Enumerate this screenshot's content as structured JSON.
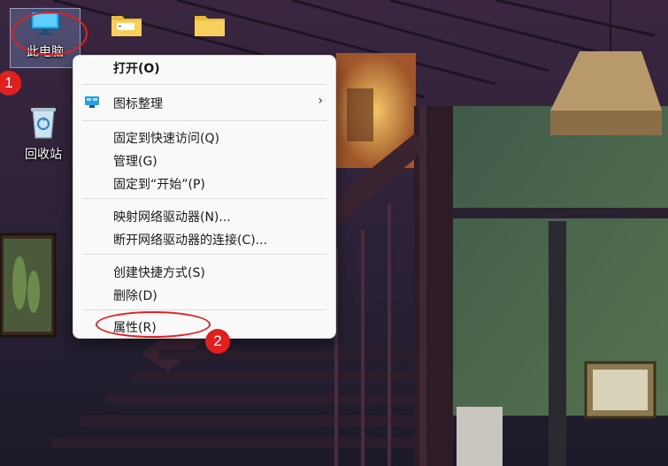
{
  "colors": {
    "menu_bg": "#f9f9f9",
    "annotation": "#e02020",
    "badge": "#e11f1f"
  },
  "desktop": {
    "icons": [
      {
        "label": "此电脑",
        "icon": "monitor-icon",
        "selected": true
      },
      {
        "label": "回收站",
        "icon": "recycle-bin-icon"
      },
      {
        "label": "",
        "icon": "folder-icon"
      },
      {
        "label": "",
        "icon": "folder-icon"
      }
    ]
  },
  "context_menu": {
    "items": [
      {
        "label": "打开(O)",
        "bold": true
      },
      {
        "label": "图标整理",
        "icon": "arrange-icons-icon",
        "submenu": true
      },
      {
        "label": "固定到快速访问(Q)"
      },
      {
        "label": "管理(G)"
      },
      {
        "label": "固定到“开始”(P)"
      },
      {
        "label": "映射网络驱动器(N)..."
      },
      {
        "label": "断开网络驱动器的连接(C)..."
      },
      {
        "label": "创建快捷方式(S)"
      },
      {
        "label": "删除(D)"
      },
      {
        "label": "属性(R)"
      }
    ]
  },
  "annotations": {
    "step1": "1",
    "step2": "2"
  }
}
